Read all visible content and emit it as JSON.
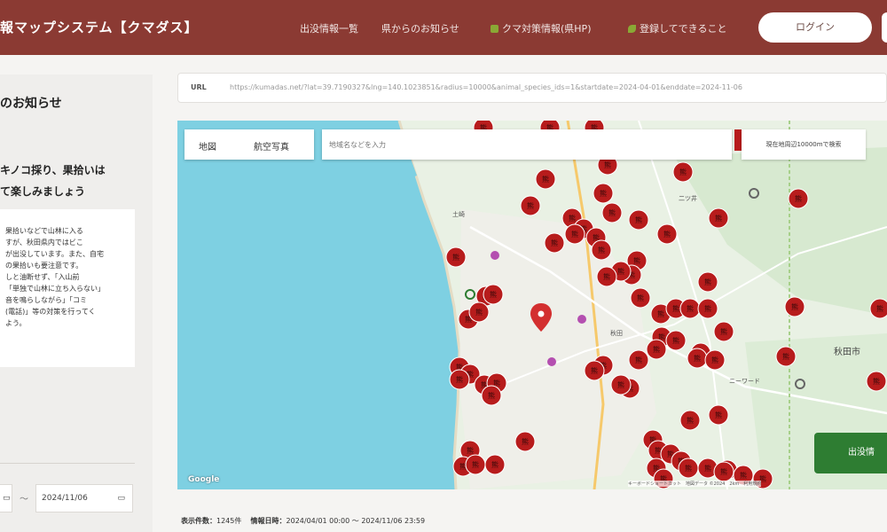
{
  "header": {
    "title": "報マップシステム【クマダス】",
    "nav": [
      {
        "label": "出没情報一覧",
        "icon": null
      },
      {
        "label": "県からのお知らせ",
        "icon": null
      },
      {
        "label": "クマ対策情報(県HP)",
        "icon": "green-square-icon"
      },
      {
        "label": "登録してできること",
        "icon": "green-leaf-icon"
      }
    ],
    "login_label": "ログイン"
  },
  "left_panel": {
    "title": "のお知らせ",
    "headline_lines": [
      "キノコ採り、果拾いは",
      "て楽しみましょう"
    ],
    "body_lines": [
      "果拾いなどで山林に入る",
      "すが、秋田県内ではビこ",
      "が出没しています。また、自宅",
      "の果拾いも要注意です。",
      "しと油断せず、「入山前",
      "「単独で山林に立ち入らない」",
      "音を鳴らしながら」「コミ",
      "(電話)」等の対策を行ってく",
      "よう。"
    ],
    "date_to": "2024/11/06",
    "date_sep": "〜"
  },
  "url_bar": {
    "label": "URL",
    "value": "https://kumadas.net/?lat=39.7190327&lng=140.1023851&radius=10000&animal_species_ids=1&startdate=2024-04-01&enddate=2024-11-06"
  },
  "map": {
    "tabs": [
      "地図",
      "航空写真"
    ],
    "search_placeholder": "地域名などを入力",
    "radius_label": "現在地周辺10000mで検索",
    "sighting_button": "出没情",
    "google_logo": "Google",
    "attribution": "キーボードショートカット　地図データ ©2024　2km　利用規約",
    "place_labels": [
      "秋田市",
      "二ツ井",
      "土崎",
      "秋田",
      "ニーワード"
    ],
    "marker_glyph": "熊"
  },
  "stats": {
    "count_label": "表示件数：",
    "count_value": "1245件",
    "period_label": "情報日時：",
    "period_value": "2024/04/01 00:00 〜 2024/11/06 23:59"
  },
  "colors": {
    "header_bg": "#8b3a33",
    "marker": "#b71c1c",
    "sea": "#7ed0e2",
    "land": "#e9f1e4",
    "primary_button": "#2e7d32"
  }
}
